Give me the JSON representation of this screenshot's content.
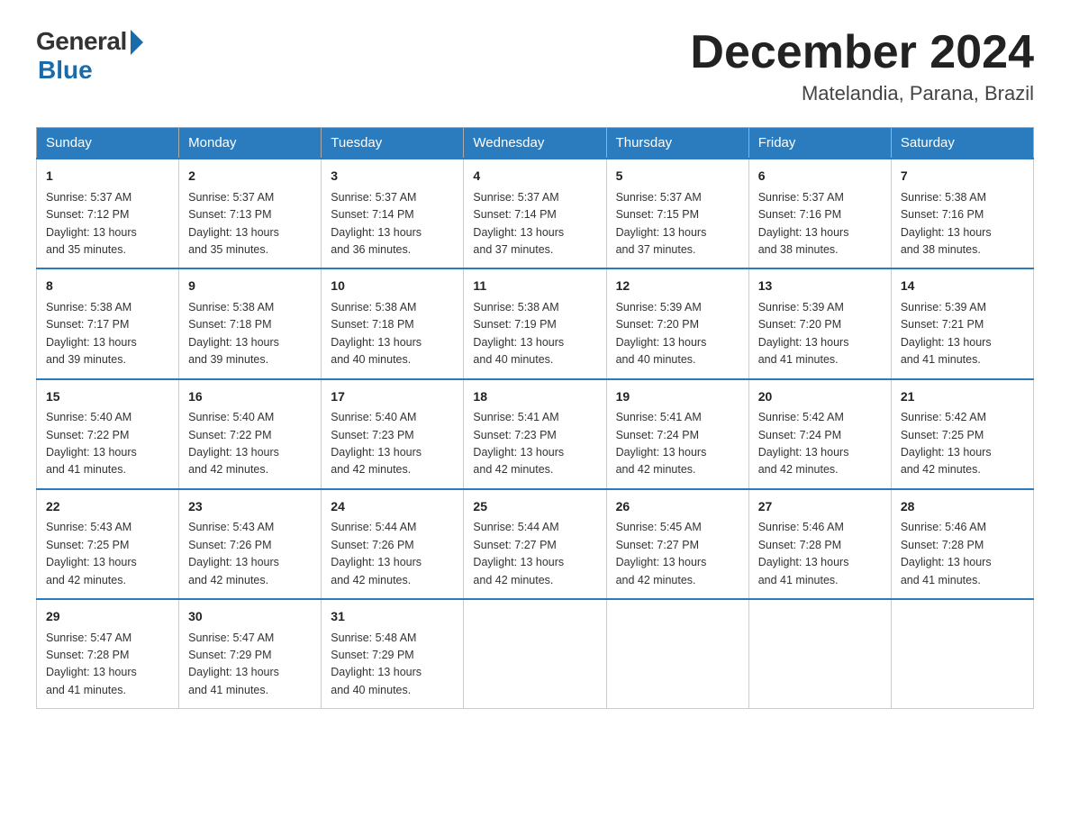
{
  "logo": {
    "general": "General",
    "blue": "Blue"
  },
  "title": {
    "month_year": "December 2024",
    "location": "Matelandia, Parana, Brazil"
  },
  "days_of_week": [
    "Sunday",
    "Monday",
    "Tuesday",
    "Wednesday",
    "Thursday",
    "Friday",
    "Saturday"
  ],
  "weeks": [
    [
      {
        "day": "1",
        "sunrise": "5:37 AM",
        "sunset": "7:12 PM",
        "daylight": "13 hours and 35 minutes."
      },
      {
        "day": "2",
        "sunrise": "5:37 AM",
        "sunset": "7:13 PM",
        "daylight": "13 hours and 35 minutes."
      },
      {
        "day": "3",
        "sunrise": "5:37 AM",
        "sunset": "7:14 PM",
        "daylight": "13 hours and 36 minutes."
      },
      {
        "day": "4",
        "sunrise": "5:37 AM",
        "sunset": "7:14 PM",
        "daylight": "13 hours and 37 minutes."
      },
      {
        "day": "5",
        "sunrise": "5:37 AM",
        "sunset": "7:15 PM",
        "daylight": "13 hours and 37 minutes."
      },
      {
        "day": "6",
        "sunrise": "5:37 AM",
        "sunset": "7:16 PM",
        "daylight": "13 hours and 38 minutes."
      },
      {
        "day": "7",
        "sunrise": "5:38 AM",
        "sunset": "7:16 PM",
        "daylight": "13 hours and 38 minutes."
      }
    ],
    [
      {
        "day": "8",
        "sunrise": "5:38 AM",
        "sunset": "7:17 PM",
        "daylight": "13 hours and 39 minutes."
      },
      {
        "day": "9",
        "sunrise": "5:38 AM",
        "sunset": "7:18 PM",
        "daylight": "13 hours and 39 minutes."
      },
      {
        "day": "10",
        "sunrise": "5:38 AM",
        "sunset": "7:18 PM",
        "daylight": "13 hours and 40 minutes."
      },
      {
        "day": "11",
        "sunrise": "5:38 AM",
        "sunset": "7:19 PM",
        "daylight": "13 hours and 40 minutes."
      },
      {
        "day": "12",
        "sunrise": "5:39 AM",
        "sunset": "7:20 PM",
        "daylight": "13 hours and 40 minutes."
      },
      {
        "day": "13",
        "sunrise": "5:39 AM",
        "sunset": "7:20 PM",
        "daylight": "13 hours and 41 minutes."
      },
      {
        "day": "14",
        "sunrise": "5:39 AM",
        "sunset": "7:21 PM",
        "daylight": "13 hours and 41 minutes."
      }
    ],
    [
      {
        "day": "15",
        "sunrise": "5:40 AM",
        "sunset": "7:22 PM",
        "daylight": "13 hours and 41 minutes."
      },
      {
        "day": "16",
        "sunrise": "5:40 AM",
        "sunset": "7:22 PM",
        "daylight": "13 hours and 42 minutes."
      },
      {
        "day": "17",
        "sunrise": "5:40 AM",
        "sunset": "7:23 PM",
        "daylight": "13 hours and 42 minutes."
      },
      {
        "day": "18",
        "sunrise": "5:41 AM",
        "sunset": "7:23 PM",
        "daylight": "13 hours and 42 minutes."
      },
      {
        "day": "19",
        "sunrise": "5:41 AM",
        "sunset": "7:24 PM",
        "daylight": "13 hours and 42 minutes."
      },
      {
        "day": "20",
        "sunrise": "5:42 AM",
        "sunset": "7:24 PM",
        "daylight": "13 hours and 42 minutes."
      },
      {
        "day": "21",
        "sunrise": "5:42 AM",
        "sunset": "7:25 PM",
        "daylight": "13 hours and 42 minutes."
      }
    ],
    [
      {
        "day": "22",
        "sunrise": "5:43 AM",
        "sunset": "7:25 PM",
        "daylight": "13 hours and 42 minutes."
      },
      {
        "day": "23",
        "sunrise": "5:43 AM",
        "sunset": "7:26 PM",
        "daylight": "13 hours and 42 minutes."
      },
      {
        "day": "24",
        "sunrise": "5:44 AM",
        "sunset": "7:26 PM",
        "daylight": "13 hours and 42 minutes."
      },
      {
        "day": "25",
        "sunrise": "5:44 AM",
        "sunset": "7:27 PM",
        "daylight": "13 hours and 42 minutes."
      },
      {
        "day": "26",
        "sunrise": "5:45 AM",
        "sunset": "7:27 PM",
        "daylight": "13 hours and 42 minutes."
      },
      {
        "day": "27",
        "sunrise": "5:46 AM",
        "sunset": "7:28 PM",
        "daylight": "13 hours and 41 minutes."
      },
      {
        "day": "28",
        "sunrise": "5:46 AM",
        "sunset": "7:28 PM",
        "daylight": "13 hours and 41 minutes."
      }
    ],
    [
      {
        "day": "29",
        "sunrise": "5:47 AM",
        "sunset": "7:28 PM",
        "daylight": "13 hours and 41 minutes."
      },
      {
        "day": "30",
        "sunrise": "5:47 AM",
        "sunset": "7:29 PM",
        "daylight": "13 hours and 41 minutes."
      },
      {
        "day": "31",
        "sunrise": "5:48 AM",
        "sunset": "7:29 PM",
        "daylight": "13 hours and 40 minutes."
      },
      null,
      null,
      null,
      null
    ]
  ],
  "labels": {
    "sunrise": "Sunrise:",
    "sunset": "Sunset:",
    "daylight": "Daylight:"
  }
}
